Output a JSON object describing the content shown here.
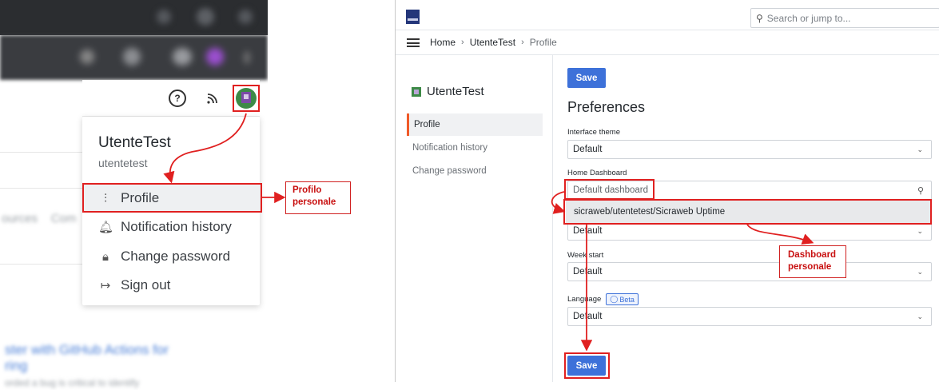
{
  "left": {
    "menu": {
      "display_name": "UtenteTest",
      "login": "utentetest",
      "items": [
        {
          "label": "Profile",
          "icon": "sliders-icon"
        },
        {
          "label": "Notification history",
          "icon": "bell-icon"
        },
        {
          "label": "Change password",
          "icon": "lock-icon"
        },
        {
          "label": "Sign out",
          "icon": "sign-out-icon"
        }
      ]
    },
    "header_icons": [
      "help-icon",
      "rss-icon",
      "avatar"
    ]
  },
  "callouts": {
    "profilo_line1": "Profilo",
    "profilo_line2": "personale",
    "dashboard_line1": "Dashboard",
    "dashboard_line2": "personale"
  },
  "grafana": {
    "search_placeholder": "Search or jump to...",
    "breadcrumb": [
      "Home",
      "UtenteTest",
      "Profile"
    ],
    "sidebar": {
      "title": "UtenteTest",
      "items": [
        "Profile",
        "Notification history",
        "Change password"
      ]
    },
    "save_label": "Save",
    "preferences_title": "Preferences",
    "fields": {
      "theme_label": "Interface theme",
      "theme_value": "Default",
      "home_label": "Home Dashboard",
      "home_placeholder": "Default dashboard",
      "home_option": "sicraweb/utentetest/Sicraweb Uptime",
      "timezone_value": "Default",
      "week_label": "Week start",
      "week_value": "Default",
      "language_label": "Language",
      "language_badge": "Beta",
      "language_value": "Default"
    }
  },
  "colors": {
    "annotation_red": "#e02020",
    "primary_blue": "#3d71d9",
    "active_orange": "#f05a28"
  }
}
